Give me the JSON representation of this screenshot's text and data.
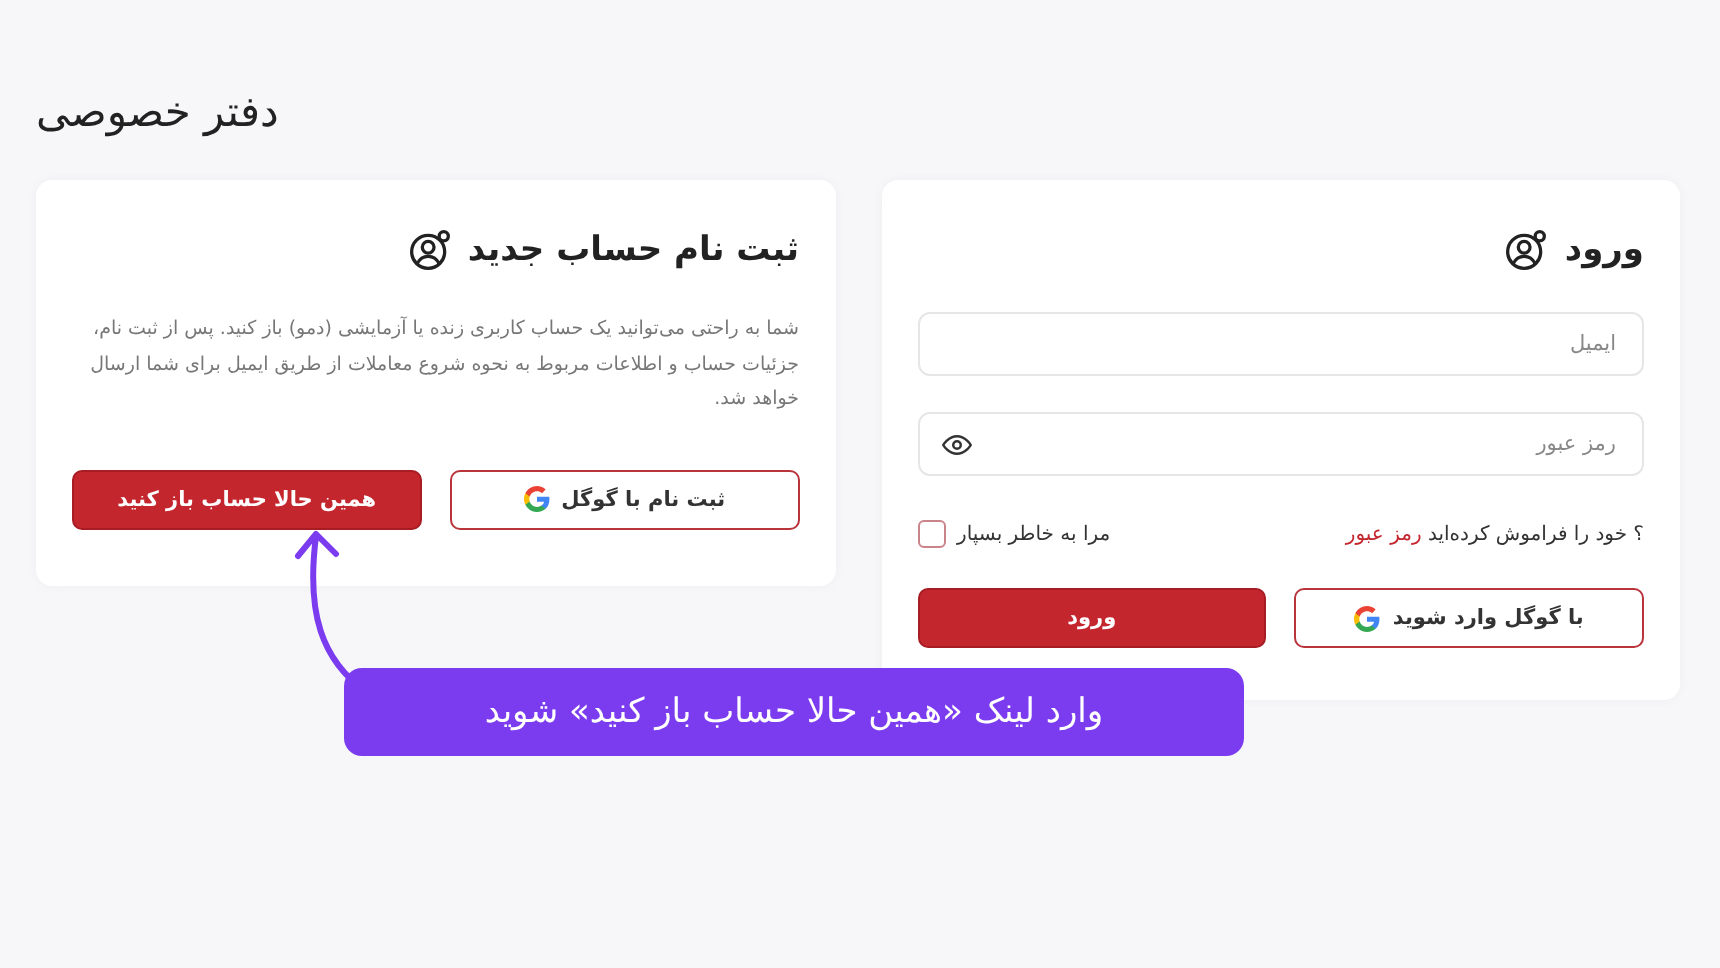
{
  "page_title": "دفتر خصوصی",
  "register": {
    "title": "ثبت نام حساب جدید",
    "description": "شما به راحتی می‌توانید یک حساب کاربری زنده یا آزمایشی (دمو) باز کنید. پس از ثبت نام، جزئیات حساب و اطلاعات مربوط به نحوه شروع معاملات از طریق ایمیل برای شما ارسال خواهد شد.",
    "google_button": "ثبت نام با گوگل",
    "primary_button": "همین حالا حساب باز کنید"
  },
  "login": {
    "title": "ورود",
    "email": {
      "placeholder": "ایمیل"
    },
    "password": {
      "placeholder": "رمز عبور"
    },
    "forgot_text": "؟ خود را فراموش کرده‌اید",
    "forgot_link": "رمز عبور",
    "remember": {
      "label": "مرا به خاطر بسپار",
      "checked": false
    },
    "primary_button": "ورود",
    "google_button": "با گوگل وارد شوید"
  },
  "callout": "وارد لینک «همین حالا حساب باز کنید» شوید"
}
